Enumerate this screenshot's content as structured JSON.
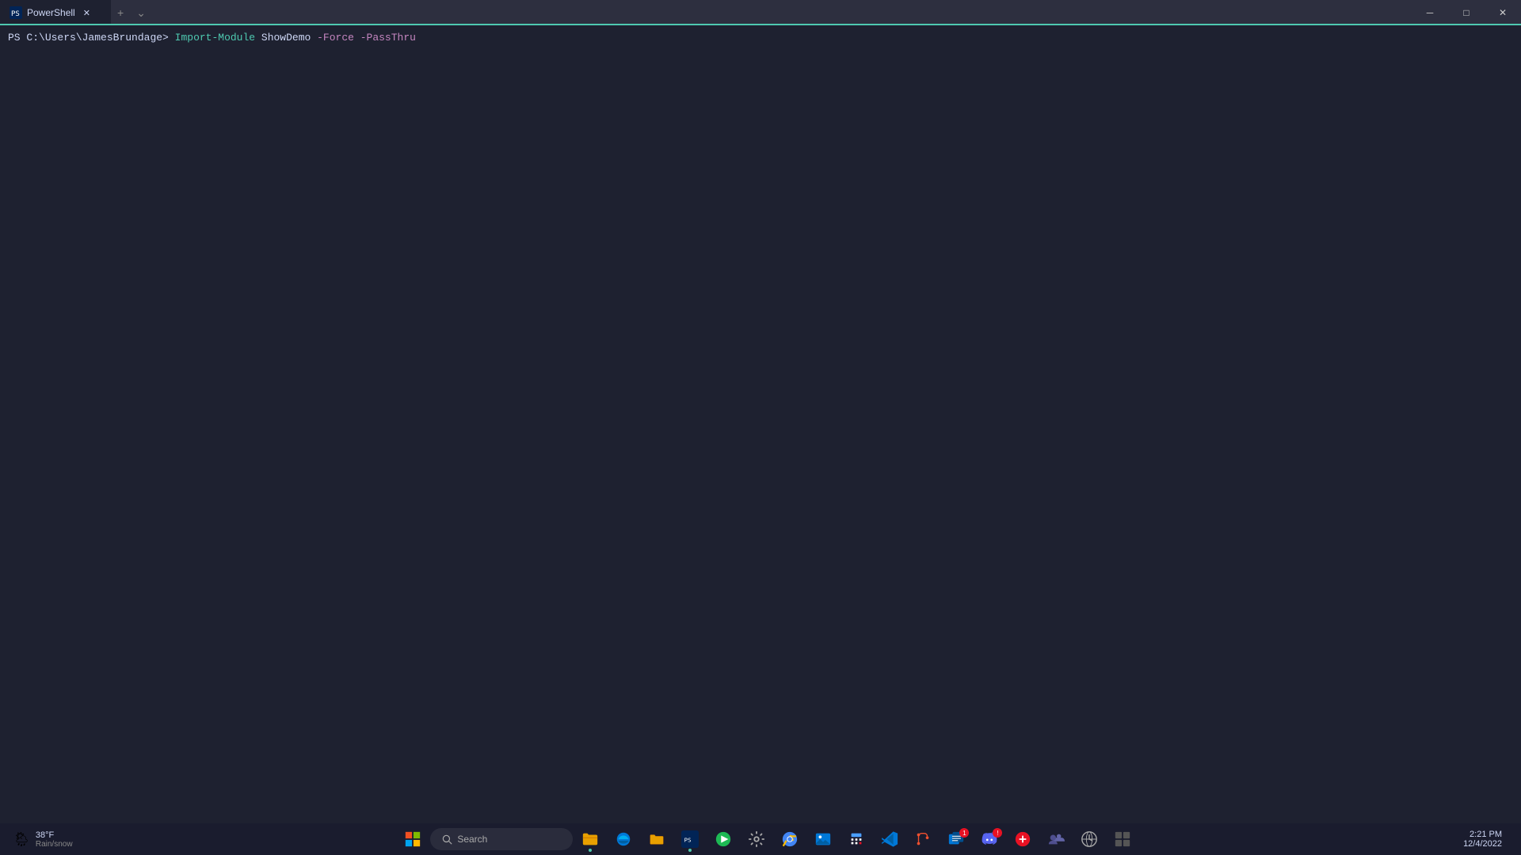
{
  "titlebar": {
    "tab_title": "PowerShell",
    "new_tab_label": "+",
    "dropdown_label": "⌄",
    "minimize_label": "─",
    "maximize_label": "□",
    "close_label": "✕"
  },
  "terminal": {
    "prompt_ps": "PS",
    "prompt_path": "C:\\Users\\JamesBrundage>",
    "command_keyword": "Import-Module",
    "command_arg": " ShowDemo",
    "command_params": " -Force -PassThru"
  },
  "taskbar": {
    "weather_icon": "🌦",
    "weather_temp": "38°F",
    "weather_cond": "Rain/snow",
    "search_label": "Search",
    "clock_time": "2:21 PM",
    "clock_date": "12/4/2022",
    "notification_badge": "1"
  }
}
